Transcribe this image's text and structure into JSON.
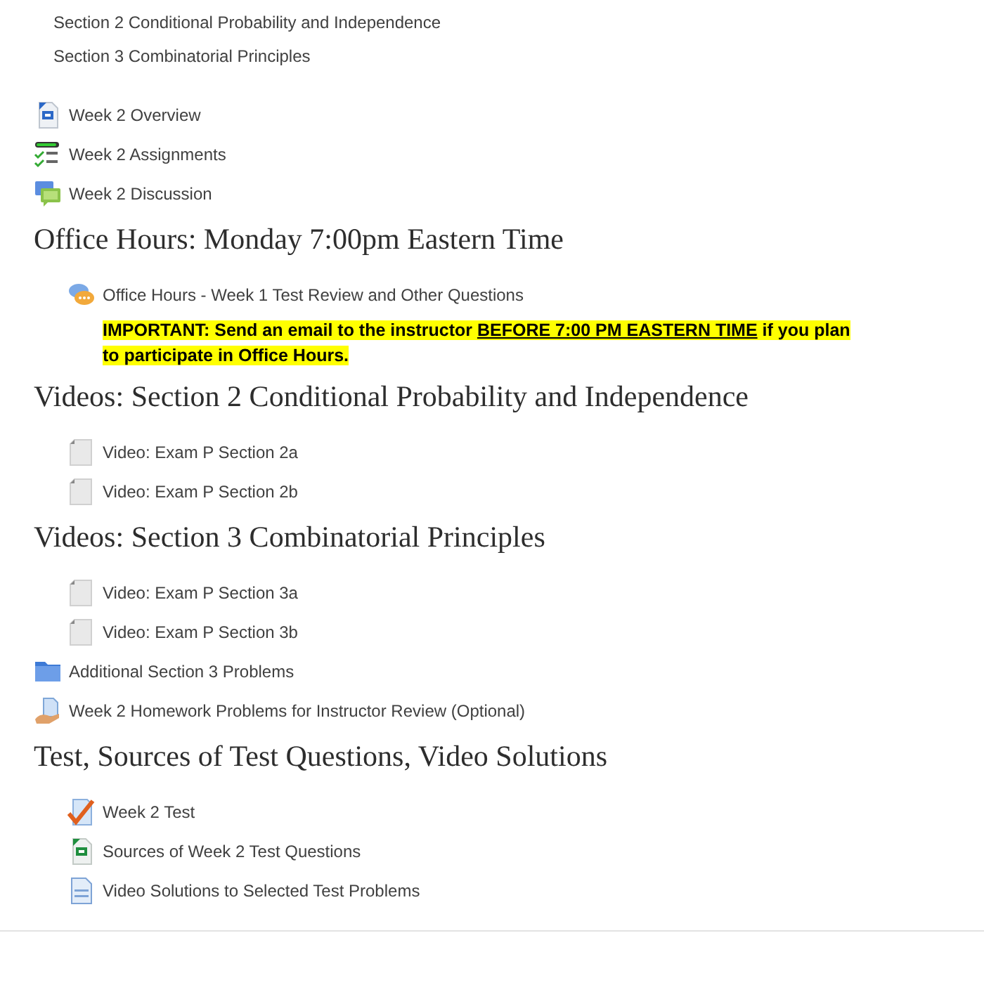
{
  "intro_lines": [
    "Section 2 Conditional Probability and Independence",
    "Section 3 Combinatorial Principles"
  ],
  "blocks": [
    {
      "kind": "word",
      "indented": false,
      "label": "Week 2 Overview"
    },
    {
      "kind": "assignment",
      "indented": false,
      "label": "Week 2 Assignments"
    },
    {
      "kind": "forum",
      "indented": false,
      "label": "Week 2 Discussion"
    },
    {
      "kind": "heading",
      "text": "Office Hours: Monday 7:00pm Eastern Time"
    },
    {
      "kind": "chat",
      "indented": true,
      "label": "Office Hours - Week 1 Test Review and Other Questions"
    },
    {
      "kind": "notice",
      "before": "IMPORTANT: Send an email to the instructor ",
      "underlined": "BEFORE 7:00 PM EASTERN TIME",
      "after": " if you plan to participate in Office Hours."
    },
    {
      "kind": "heading",
      "text": "Videos: Section 2 Conditional Probability and Independence"
    },
    {
      "kind": "file",
      "indented": true,
      "label": "Video: Exam P Section 2a"
    },
    {
      "kind": "file",
      "indented": true,
      "label": "Video: Exam P Section 2b"
    },
    {
      "kind": "heading",
      "text": "Videos: Section 3 Combinatorial Principles"
    },
    {
      "kind": "file",
      "indented": true,
      "label": "Video: Exam P Section 3a"
    },
    {
      "kind": "file",
      "indented": true,
      "label": "Video: Exam P Section 3b"
    },
    {
      "kind": "folder",
      "indented": false,
      "label": "Additional Section 3 Problems"
    },
    {
      "kind": "hand",
      "indented": false,
      "label": "Week 2 Homework Problems for Instructor Review (Optional)"
    },
    {
      "kind": "heading",
      "text": "Test, Sources of Test Questions, Video Solutions"
    },
    {
      "kind": "quiz",
      "indented": true,
      "label": "Week 2 Test"
    },
    {
      "kind": "excel",
      "indented": true,
      "label": "Sources of Week 2 Test Questions"
    },
    {
      "kind": "page",
      "indented": true,
      "label": "Video Solutions to Selected Test Problems"
    }
  ]
}
